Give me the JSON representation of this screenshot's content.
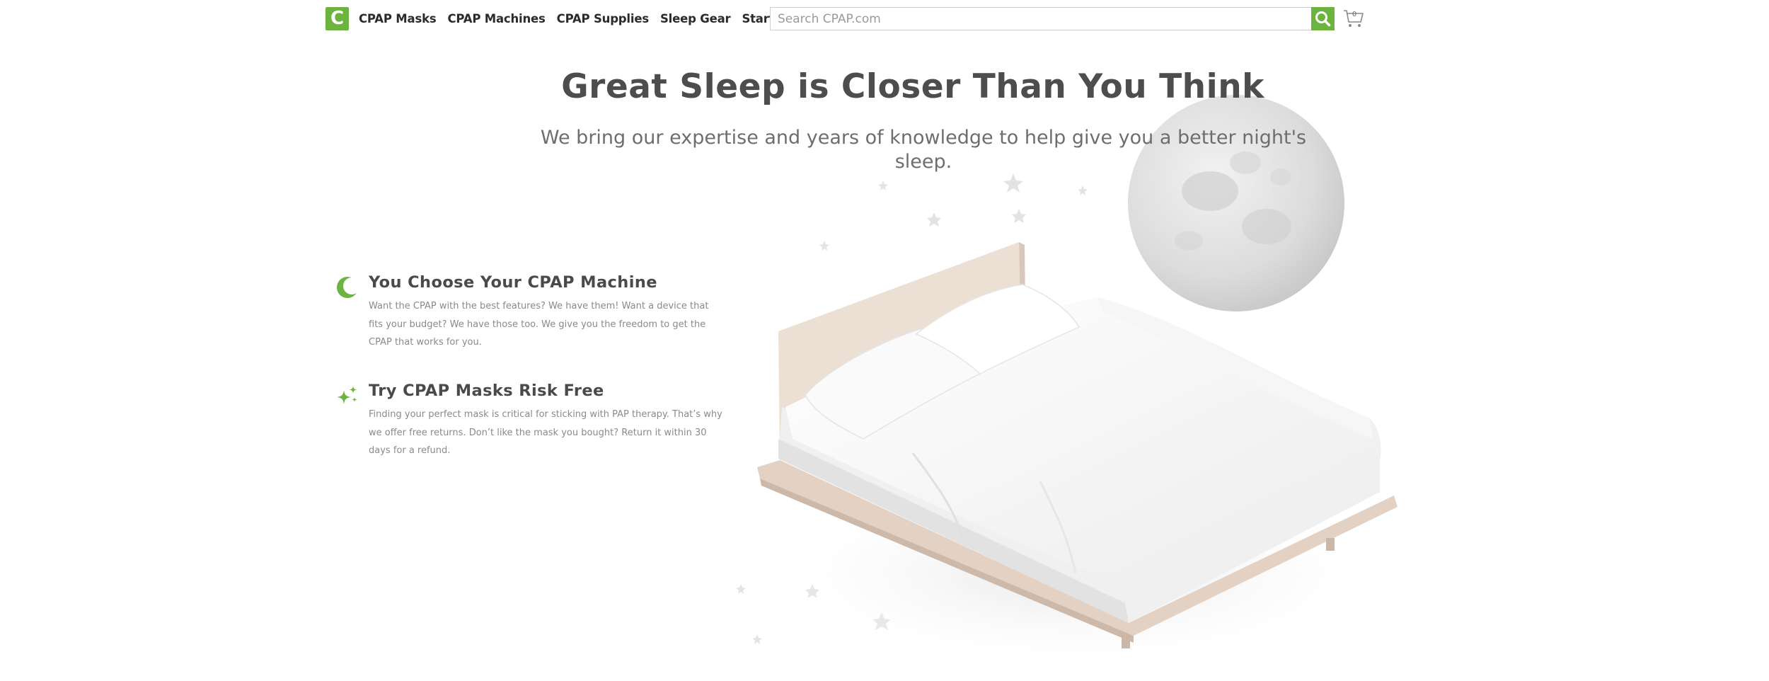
{
  "header": {
    "logo_letter": "C",
    "nav": [
      {
        "label": "CPAP Masks"
      },
      {
        "label": "CPAP Machines"
      },
      {
        "label": "CPAP Supplies"
      },
      {
        "label": "Sleep Gear"
      },
      {
        "label": "Starter Pack"
      }
    ],
    "search": {
      "placeholder": "Search CPAP.com",
      "value": ""
    },
    "cart": {
      "count": "0"
    }
  },
  "hero": {
    "title": "Great Sleep is Closer Than You Think",
    "subtitle": "We bring our expertise and years of knowledge to help give you a better night's sleep."
  },
  "features": [
    {
      "title": "You Choose Your CPAP Machine",
      "body": "Want the CPAP with the best features? We have them! Want a device that fits your budget? We have those too. We give you the freedom to get the CPAP that works for you.",
      "icon": "crescent-moon-icon"
    },
    {
      "title": "Try CPAP Masks Risk Free",
      "body": "Finding your perfect mask is critical for sticking with PAP therapy. That’s why we offer free returns. Don’t like the mask you bought? Return it within 30 days for a refund.",
      "icon": "sparkles-icon"
    }
  ],
  "colors": {
    "brand_green": "#6cb33f",
    "heading": "#4d4d4d",
    "body_text": "#8a8a8a"
  }
}
